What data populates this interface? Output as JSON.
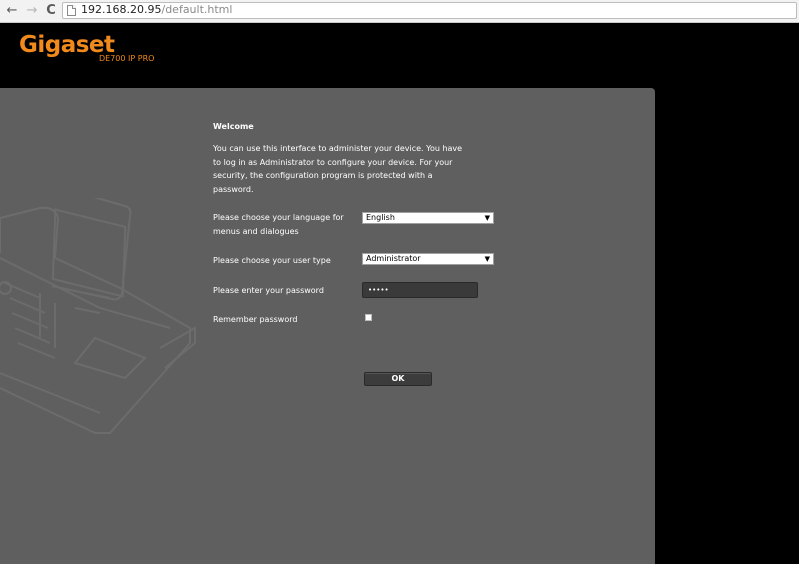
{
  "browser": {
    "url_host": "192.168.20.95",
    "url_path": "/default.html",
    "back_icon": "←",
    "forward_icon": "→",
    "reload_icon": "C"
  },
  "header": {
    "logo": "Gigaset",
    "model": "DE700 IP PRO",
    "brand_color": "#f08a1c"
  },
  "login": {
    "title": "Welcome",
    "intro": "You can use this interface to administer your device. You have to log in as Administrator to configure your device. For your security, the configuration program is protected with a password.",
    "language_label": "Please choose your language for menus and dialogues",
    "language_value": "English",
    "user_type_label": "Please choose your user type",
    "user_type_value": "Administrator",
    "password_label": "Please enter your password",
    "password_value": "•••••",
    "remember_label": "Remember password",
    "remember_checked": false,
    "ok_label": "OK"
  },
  "colors": {
    "panel_bg": "#5f5f5f",
    "page_bg": "#000000"
  },
  "icons": {
    "select_arrow": "▼"
  }
}
